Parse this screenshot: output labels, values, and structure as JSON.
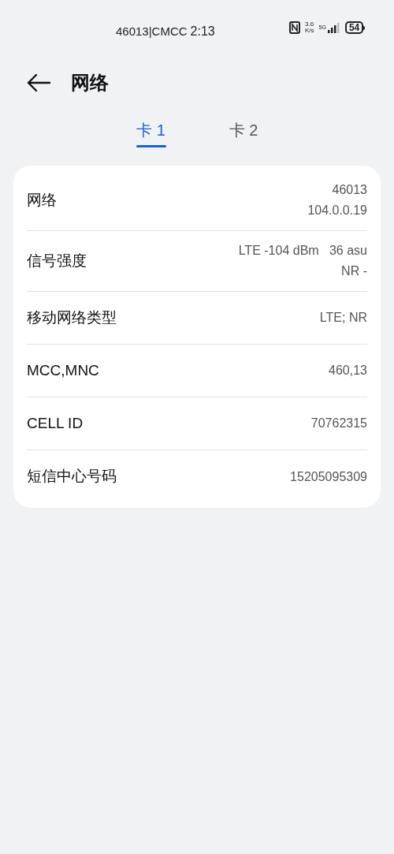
{
  "status_bar": {
    "carrier": "46013|CMCC",
    "time": "2:13",
    "speed_value": "3.6",
    "speed_unit": "K/s",
    "network": "5G",
    "battery": "54"
  },
  "header": {
    "title": "网络"
  },
  "tabs": [
    {
      "label": "卡 1",
      "selected": true
    },
    {
      "label": "卡 2",
      "selected": false
    }
  ],
  "rows": [
    {
      "label": "网络",
      "value": [
        "46013",
        "104.0.0.19"
      ]
    },
    {
      "label": "信号强度",
      "value": [
        "LTE -104 dBm   36 asu",
        "NR -"
      ]
    },
    {
      "label": "移动网络类型",
      "value": [
        "LTE; NR"
      ]
    },
    {
      "label": "MCC,MNC",
      "value": [
        "460,13"
      ]
    },
    {
      "label": "CELL ID",
      "value": [
        "70762315"
      ]
    },
    {
      "label": "短信中心号码",
      "value": [
        "15205095309"
      ]
    }
  ]
}
